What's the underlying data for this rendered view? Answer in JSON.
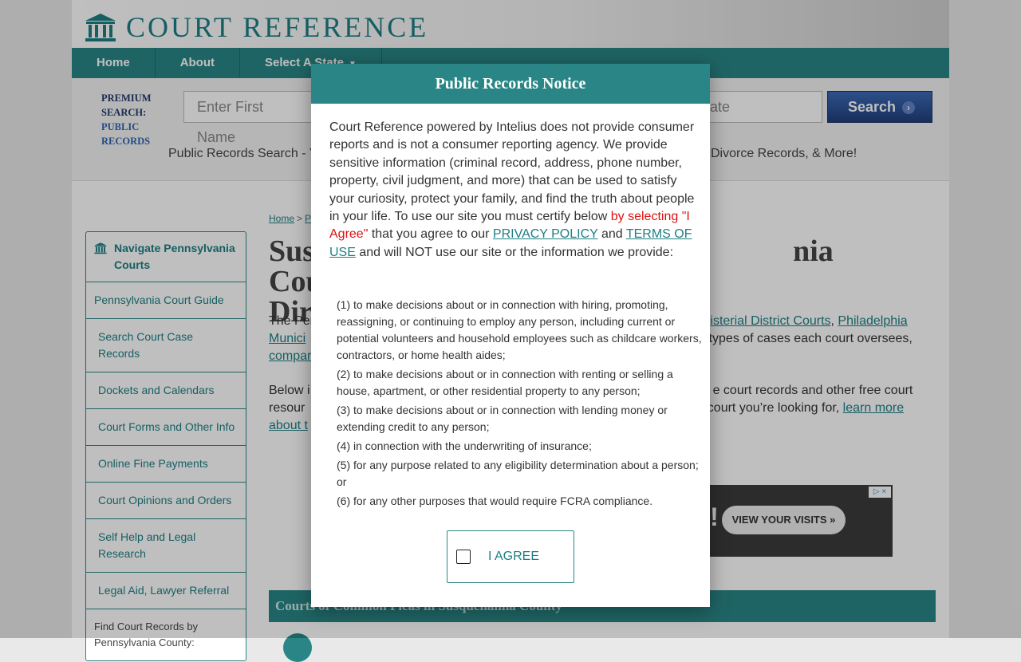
{
  "brand": {
    "name": "COURT REFERENCE",
    "logo_icon": "courthouse-icon",
    "accent": "#2a8686"
  },
  "nav": {
    "items": [
      "Home",
      "About",
      "Select A State"
    ]
  },
  "search": {
    "premium_line1": "PREMIUM SEARCH:",
    "premium_line2": "PUBLIC RECORDS",
    "first_name_placeholder": "Enter First Name",
    "state_placeholder": "tate",
    "button_label": "Search",
    "tagline_left": "Public Records Search - Y",
    "tagline_right": "Divorce Records, & More!"
  },
  "sidebar": {
    "title": "Navigate Pennsylvania Courts",
    "items": [
      "Pennsylvania Court Guide",
      "Search Court Case Records",
      "Dockets and Calendars",
      "Court Forms and Other Info",
      "Online Fine Payments",
      "Court Opinions and Orders",
      "Self Help and Legal Research",
      "Legal Aid, Lawyer Referral"
    ],
    "footer_text": "Find Court Records by Pennsylvania County:"
  },
  "breadcrumb": {
    "home": "Home",
    "sep": ">",
    "next": "P"
  },
  "page": {
    "title_line1_left": "Sus",
    "title_line1_right": "nia Court",
    "title_line2": "Dir"
  },
  "content": {
    "p1_start": "The Pen",
    "p1_link_mdc": "gisterial District Courts",
    "p1_comma": ",",
    "p1_link_phila": "Philadelphia",
    "p1_line2_link": "Munici",
    "p1_line2_right": "ch types of cases each court oversees,",
    "p1_line3_link": "compar",
    "p2_start": "Below i",
    "p2_right": "e court records and other free court",
    "p2_line2_start": "resour",
    "p2_line2_right": " court you’re looking for, ",
    "p2_link_learn": "learn more",
    "p2_line3_link": "about t"
  },
  "ad": {
    "headline_tail": "ou!",
    "button_label": "VIEW YOUR VISITS »",
    "choices": "▷ ×"
  },
  "section": {
    "heading": "Courts of Common Pleas in Susquehanna County"
  },
  "modal": {
    "title": "Public Records Notice",
    "intro": "Court Reference powered by Intelius does not provide consumer reports and is not a consumer reporting agency. We provide sensitive information (criminal record, address, phone number, property, civil judgment, and more) that can be used to satisfy your curiosity, protect your family, and find the truth about people in your life. To use our site you must certify below ",
    "intro_red": "by selecting \"I Agree\"",
    "intro_mid": " that you agree to our ",
    "privacy_link": "PRIVACY POLICY",
    "intro_and": " and ",
    "terms_link": "TERMS OF USE",
    "intro_end": " and will NOT use our site or the information we provide:",
    "rules": [
      "(1) to make decisions about or in connection with hiring, promoting, reassigning, or continuing to employ any person, including current or potential volunteers and household employees such as childcare workers, contractors, or home health aides;",
      "(2) to make decisions about or in connection with renting or selling a house, apartment, or other residential property to any person;",
      "(3) to make decisions about or in connection with lending money or extending credit to any person;",
      "(4) in connection with the underwriting of insurance;",
      "(5) for any purpose related to any eligibility determination about a person; or",
      "(6) for any other purposes that would require FCRA compliance."
    ],
    "agree_label": "I AGREE",
    "agree_checked": false
  }
}
